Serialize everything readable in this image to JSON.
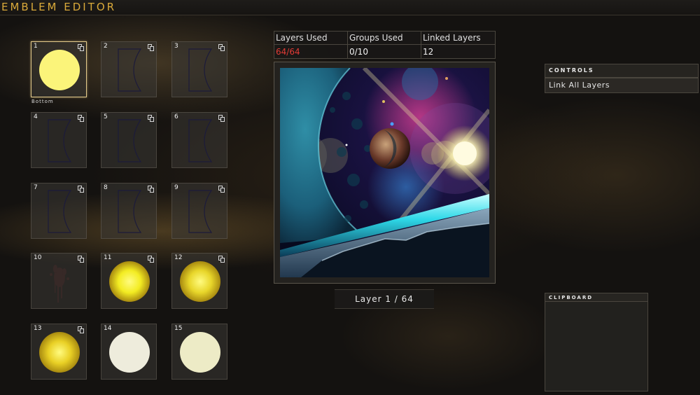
{
  "title": "EMBLEM EDITOR",
  "stats": {
    "layers_used_label": "Layers Used",
    "layers_used_value": "64/64",
    "groups_used_label": "Groups Used",
    "groups_used_value": "0/10",
    "linked_layers_label": "Linked Layers",
    "linked_layers_value": "12"
  },
  "layer_grid": {
    "bottom_label": "Bottom",
    "tiles": [
      {
        "number": "1",
        "shape": "circle",
        "color": "#fbf47a",
        "linked": true,
        "selected": true
      },
      {
        "number": "2",
        "shape": "crescent-outline",
        "color": "#1c1b3a",
        "linked": true
      },
      {
        "number": "3",
        "shape": "crescent-outline",
        "color": "#1c1b3a",
        "linked": true
      },
      {
        "number": "4",
        "shape": "crescent-outline",
        "color": "#1c1b3a",
        "linked": true
      },
      {
        "number": "5",
        "shape": "crescent-outline",
        "color": "#1c1b3a",
        "linked": true
      },
      {
        "number": "6",
        "shape": "crescent-outline",
        "color": "#1c1b3a",
        "linked": true
      },
      {
        "number": "7",
        "shape": "crescent-outline",
        "color": "#1c1b3a",
        "linked": true
      },
      {
        "number": "8",
        "shape": "crescent-outline",
        "color": "#1c1b3a",
        "linked": true
      },
      {
        "number": "9",
        "shape": "crescent-outline",
        "color": "#1c1b3a",
        "linked": true
      },
      {
        "number": "10",
        "shape": "splatter",
        "color": "#3a2a28",
        "linked": true
      },
      {
        "number": "11",
        "shape": "radial-circle",
        "color": "#f3ec22",
        "linked": true
      },
      {
        "number": "12",
        "shape": "radial-circle",
        "color": "#e8d62a",
        "linked": true
      },
      {
        "number": "13",
        "shape": "radial-circle",
        "color": "#e9d025",
        "linked": true
      },
      {
        "number": "14",
        "shape": "circle",
        "color": "#eeecdc",
        "linked": false
      },
      {
        "number": "15",
        "shape": "circle",
        "color": "#edebc6",
        "linked": false
      }
    ]
  },
  "layer_indicator": "Layer 1 / 64",
  "controls": {
    "header": "CONTROLS",
    "items": [
      "Link All Layers"
    ]
  },
  "clipboard": {
    "header": "CLIPBOARD"
  },
  "colors": {
    "title_accent": "#d9a93a",
    "alert_red": "#e23b35",
    "selected_border": "#e2c98a"
  }
}
